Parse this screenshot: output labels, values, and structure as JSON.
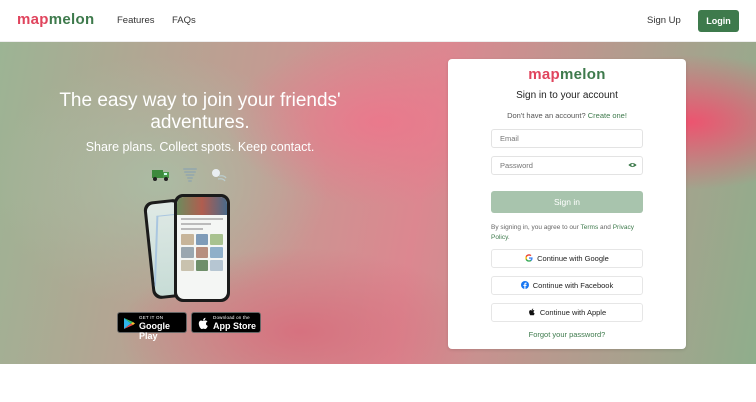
{
  "nav": {
    "logo_part1": "map",
    "logo_part2": "melon",
    "features": "Features",
    "faqs": "FAQs",
    "signup": "Sign Up",
    "login": "Login"
  },
  "hero": {
    "title": "The easy way to join your friends' adventures.",
    "subtitle": "Share plans. Collect spots. Keep contact.",
    "emojis": [
      "truck-icon",
      "tornado-icon",
      "wind-icon"
    ],
    "google_play_small": "GET IT ON",
    "google_play_big": "Google Play",
    "app_store_small": "Download on the",
    "app_store_big": "App Store"
  },
  "card": {
    "logo_part1": "map",
    "logo_part2": "melon",
    "title": "Sign in to your account",
    "no_account": "Don't have an account?",
    "create_link": "Create one!",
    "email_placeholder": "Email",
    "password_placeholder": "Password",
    "signin": "Sign in",
    "terms_prefix": "By signing in, you agree to our",
    "terms_link": "Terms",
    "terms_and": "and",
    "privacy_link": "Privacy Policy",
    "terms_suffix": ".",
    "google": "Continue with Google",
    "facebook": "Continue with Facebook",
    "apple": "Continue with Apple",
    "forgot": "Forgot your password?"
  },
  "colors": {
    "brand_red": "#e0445d",
    "brand_green": "#3e7a4c",
    "signin_disabled": "#a8c4ad"
  }
}
